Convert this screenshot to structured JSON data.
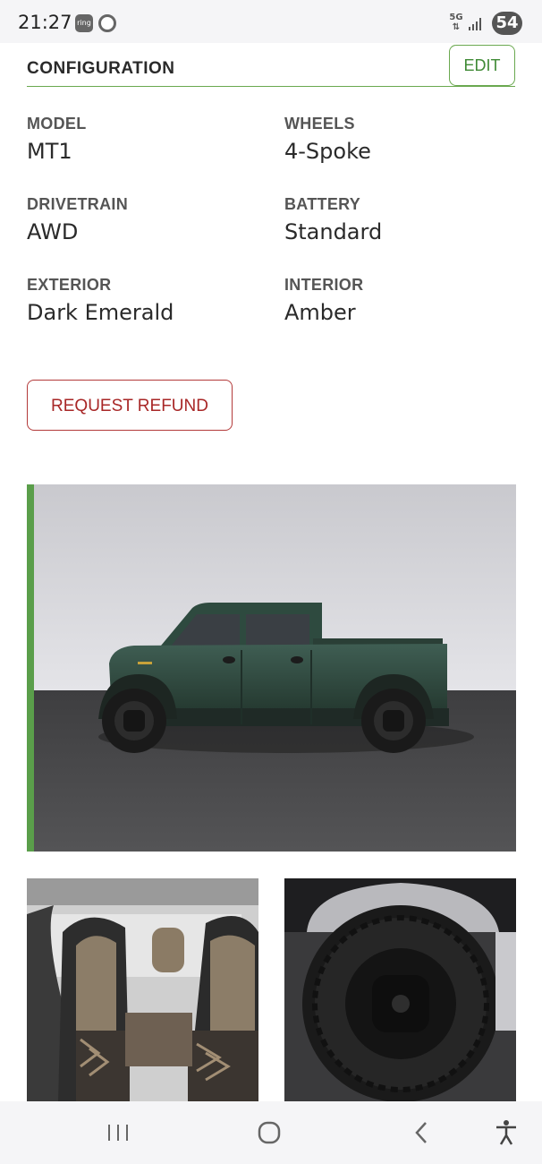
{
  "status_bar": {
    "time": "21:27",
    "left_icons": [
      "ring-icon",
      "chrome-icon"
    ],
    "network": "5G",
    "battery": "54"
  },
  "configuration": {
    "title": "CONFIGURATION",
    "edit_label": "EDIT",
    "specs": [
      {
        "label": "MODEL",
        "value": "MT1"
      },
      {
        "label": "WHEELS",
        "value": "4-Spoke"
      },
      {
        "label": "DRIVETRAIN",
        "value": "AWD"
      },
      {
        "label": "BATTERY",
        "value": "Standard"
      },
      {
        "label": "EXTERIOR",
        "value": "Dark Emerald"
      },
      {
        "label": "INTERIOR",
        "value": "Amber"
      }
    ],
    "refund_label": "REQUEST REFUND"
  },
  "gallery": {
    "hero": "truck-side-view-image",
    "thumbnails": [
      "interior-seats-image",
      "wheel-closeup-image"
    ]
  },
  "nav_bar": {
    "buttons": [
      "recent-apps-icon",
      "home-icon",
      "back-icon",
      "accessibility-icon"
    ]
  },
  "colors": {
    "accent_green": "#5a9e4a",
    "refund_red": "#a82727",
    "truck_body": "#2f4a40"
  }
}
